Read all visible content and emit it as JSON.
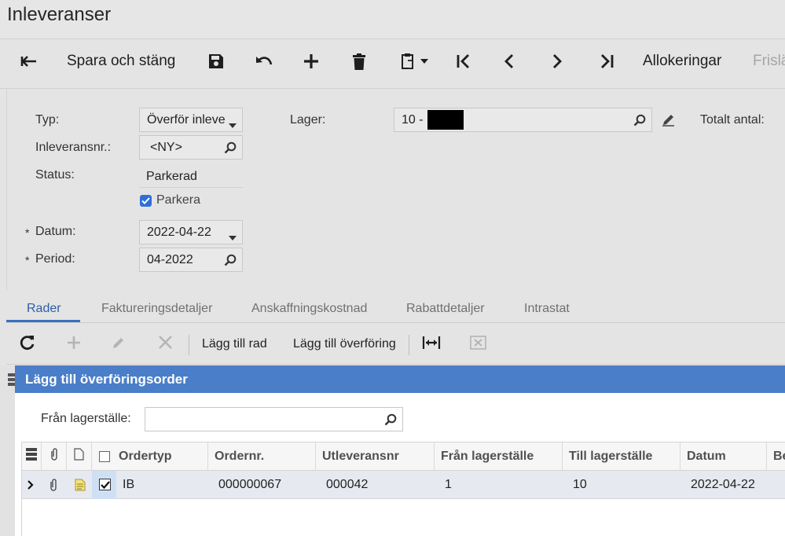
{
  "page": {
    "title": "Inleveranser"
  },
  "toolbar": {
    "save_close_label": "Spara och stäng",
    "allocations_label": "Allokeringar",
    "release_label": "Frisläpp"
  },
  "form": {
    "type_label": "Typ:",
    "type_value": "Överför inleve",
    "receipt_nbr_label": "Inleveransnr.:",
    "receipt_nbr_value": "<NY>",
    "status_label": "Status:",
    "status_value": "Parkerad",
    "hold_label": "Parkera",
    "hold_checked": true,
    "date_label": "Datum:",
    "date_value": "2022-04-22",
    "period_label": "Period:",
    "period_value": "04-2022",
    "warehouse_label": "Lager:",
    "warehouse_value": "10 -",
    "total_qty_label": "Totalt antal:",
    "required_marker": "*"
  },
  "tabs": [
    {
      "label": "Rader",
      "active": true
    },
    {
      "label": "Faktureringsdetaljer",
      "active": false
    },
    {
      "label": "Anskaffningskostnad",
      "active": false
    },
    {
      "label": "Rabattdetaljer",
      "active": false
    },
    {
      "label": "Intrastat",
      "active": false
    }
  ],
  "grid_toolbar": {
    "add_line_label": "Lägg till rad",
    "add_transfer_label": "Lägg till överföring"
  },
  "dialog": {
    "title": "Lägg till överföringsorder",
    "from_warehouse_label": "Från lagerställe:",
    "from_warehouse_value": "",
    "columns": [
      "Ordertyp",
      "Ordernr.",
      "Utleveransnr",
      "Från lagerställe",
      "Till lagerställe",
      "Datum",
      "Be"
    ],
    "rows": [
      {
        "selected": true,
        "order_type": "IB",
        "order_nbr": "000000067",
        "shipment_nbr": "000042",
        "from_site": "1",
        "to_site": "10",
        "date": "2022-04-22"
      }
    ]
  },
  "colors": {
    "accent": "#4a7ec8",
    "checkbox": "#2f6fd6",
    "tab_active": "#2c5fa8"
  }
}
